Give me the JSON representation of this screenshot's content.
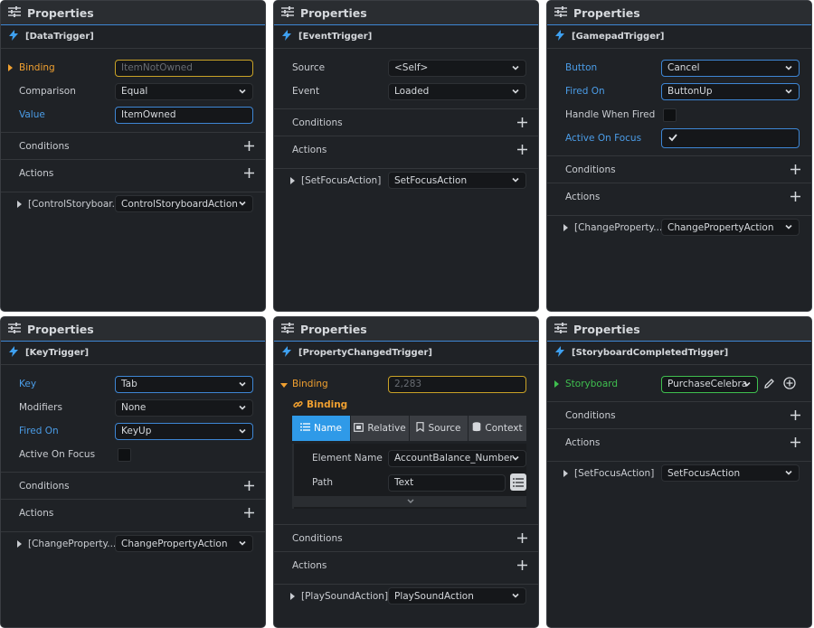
{
  "header_title": "Properties",
  "colors": {
    "accent": "#3e86d4",
    "bolt": "#3ea0f0",
    "orange": "#f0a030",
    "green": "#3fbf4f"
  },
  "common": {
    "conditions": "Conditions",
    "actions": "Actions"
  },
  "p1": {
    "trigger": "[DataTrigger]",
    "binding_label": "Binding",
    "binding_placeholder": "ItemNotOwned",
    "comparison_label": "Comparison",
    "comparison_value": "Equal",
    "value_label": "Value",
    "value_value": "ItemOwned",
    "action_item": "[ControlStoryboar...",
    "action_value": "ControlStoryboardAction"
  },
  "p2": {
    "trigger": "[EventTrigger]",
    "source_label": "Source",
    "source_value": "<Self>",
    "event_label": "Event",
    "event_value": "Loaded",
    "action_item": "[SetFocusAction]",
    "action_value": "SetFocusAction"
  },
  "p3": {
    "trigger": "[GamepadTrigger]",
    "button_label": "Button",
    "button_value": "Cancel",
    "firedon_label": "Fired On",
    "firedon_value": "ButtonUp",
    "handle_label": "Handle When Fired",
    "focus_label": "Active On Focus",
    "action_item": "[ChangeProperty...",
    "action_value": "ChangePropertyAction"
  },
  "p4": {
    "trigger": "[KeyTrigger]",
    "key_label": "Key",
    "key_value": "Tab",
    "mod_label": "Modifiers",
    "mod_value": "None",
    "firedon_label": "Fired On",
    "firedon_value": "KeyUp",
    "focus_label": "Active On Focus",
    "action_item": "[ChangeProperty...",
    "action_value": "ChangePropertyAction"
  },
  "p5": {
    "trigger": "[PropertyChangedTrigger]",
    "binding_label": "Binding",
    "binding_placeholder": "2,283",
    "binding_sub": "Binding",
    "tabs": [
      "Name",
      "Relative",
      "Source",
      "Context"
    ],
    "element_label": "Element Name",
    "element_value": "AccountBalance_Number",
    "path_label": "Path",
    "path_value": "Text",
    "action_item": "[PlaySoundAction]",
    "action_value": "PlaySoundAction"
  },
  "p6": {
    "trigger": "[StoryboardCompletedTrigger]",
    "storyboard_label": "Storyboard",
    "storyboard_value": "PurchaseCelebra",
    "action_item": "[SetFocusAction]",
    "action_value": "SetFocusAction"
  }
}
